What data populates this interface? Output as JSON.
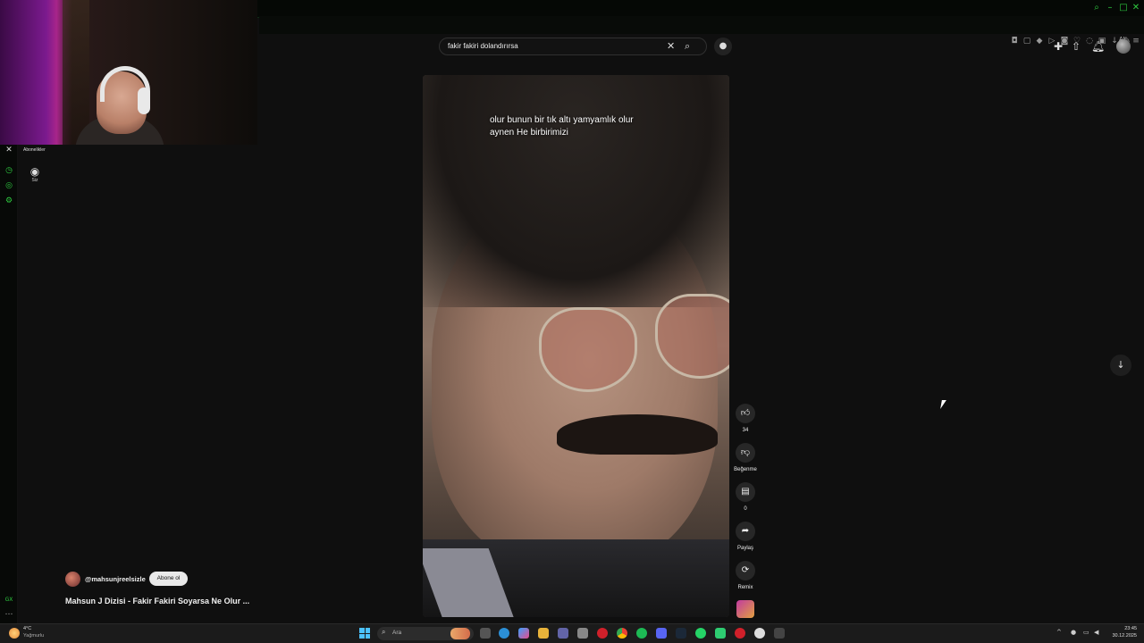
{
  "browser": {
    "ext_label": "AI"
  },
  "sidebar_label": "Abonelikler",
  "you_entry": {
    "icon": "user-circle-icon",
    "label": "Siz"
  },
  "search": {
    "query": "fakir fakiri dolandırırsa",
    "clear_icon": "close-icon",
    "search_icon": "search-icon",
    "mic_icon": "microphone-icon"
  },
  "header_icons": [
    "create-icon",
    "upload-icon",
    "notifications-icon",
    "avatar"
  ],
  "video": {
    "caption_line1": "olur bunun bir tık altı yamyamlık olur",
    "caption_line2": "aynen He birbirimizi"
  },
  "actions": {
    "like_count": "34",
    "dislike_label": "Beğenme",
    "comment_count": "0",
    "share_label": "Paylaş",
    "remix_label": "Remix"
  },
  "channel": {
    "handle": "@mahsunjreelsizle",
    "subscribe_label": "Abone ol"
  },
  "video_title": "Mahsun J Dizisi - Fakir Fakiri Soyarsa Ne Olur ...",
  "taskbar": {
    "weather_temp": "4°C",
    "weather_desc": "Yağmurlu",
    "search_placeholder": "Ara",
    "time": "23:45",
    "date": "30.12.2025"
  },
  "colors": {
    "accent_gx": "#2ecc40",
    "background": "#0f0f0f",
    "subscribe_bg": "#e9e9e9"
  }
}
